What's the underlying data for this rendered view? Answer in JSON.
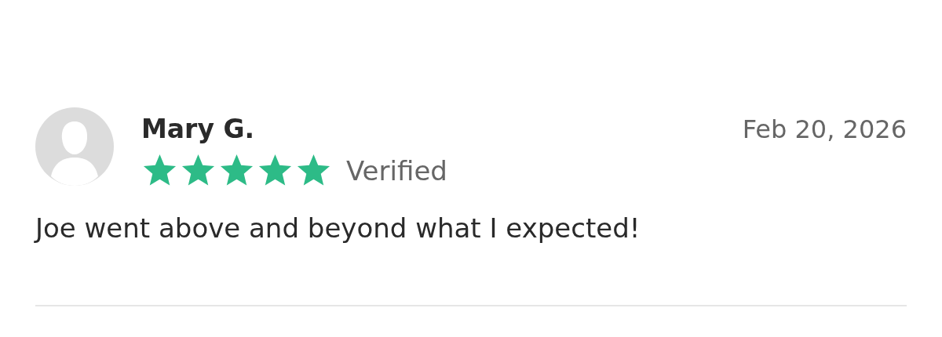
{
  "review": {
    "author": "Mary G.",
    "date": "Feb 20, 2026",
    "stars": 5,
    "badge": "Verified",
    "text": "Joe went above and beyond what I expected!"
  }
}
